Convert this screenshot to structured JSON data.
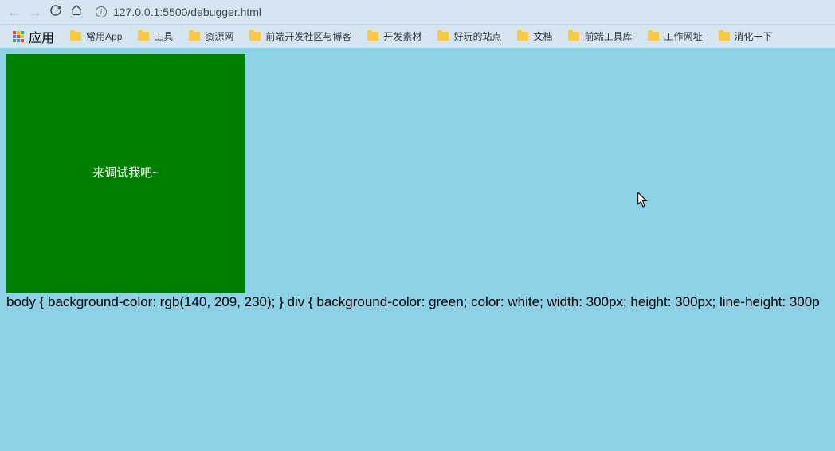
{
  "nav": {
    "back": "←",
    "forward": "→",
    "reload": "↻",
    "home": "⌂"
  },
  "url": "127.0.0.1:5500/debugger.html",
  "apps_label": "应用",
  "bookmarks": [
    "常用App",
    "工具",
    "资源网",
    "前端开发社区与博客",
    "开发素材",
    "好玩的站点",
    "文档",
    "前端工具库",
    "工作网址",
    "消化一下"
  ],
  "page": {
    "box_text": "来调试我吧~",
    "css_text": "body { background-color: rgb(140, 209, 230); } div { background-color: green; color: white; width: 300px; height: 300px; line-height: 300p"
  }
}
